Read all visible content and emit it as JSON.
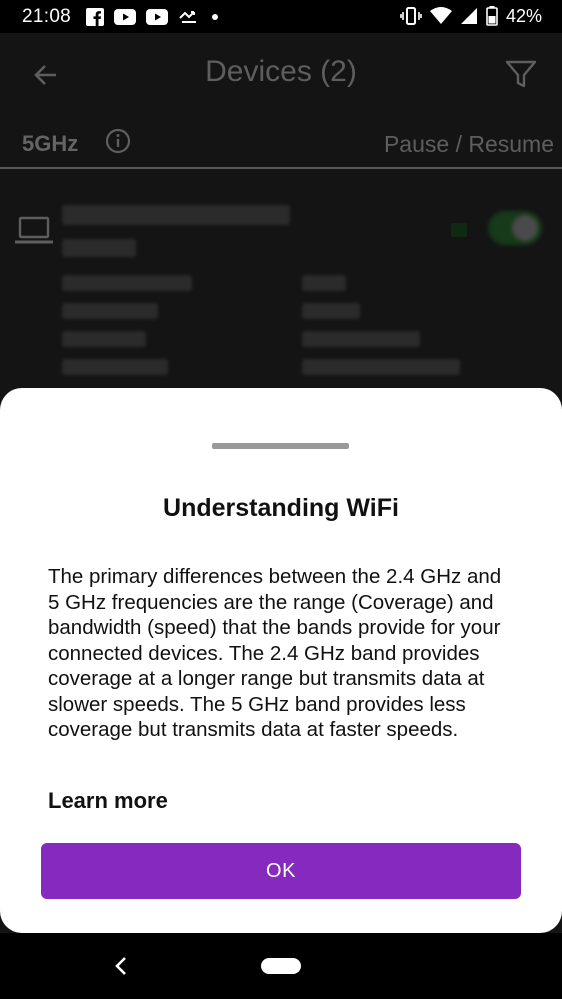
{
  "status_bar": {
    "time": "21:08",
    "battery_percent": "42%",
    "left_icons": [
      "facebook-icon",
      "youtube-icon",
      "youtube-icon",
      "sync-icon",
      "dot-icon"
    ],
    "right_icons": [
      "vibrate-icon",
      "wifi-icon",
      "cell-signal-icon",
      "battery-icon"
    ]
  },
  "header": {
    "title": "Devices (2)"
  },
  "band_row": {
    "band": "5GHz",
    "action": "Pause / Resume"
  },
  "sheet": {
    "title": "Understanding WiFi",
    "body": "The primary differences between the 2.4 GHz and 5 GHz frequencies are the range (Coverage) and bandwidth (speed) that the bands provide for your connected devices. The 2.4 GHz band provides coverage at a longer range but transmits data at slower speeds. The 5 GHz band provides less coverage but transmits data at faster speeds.",
    "learn_more": "Learn more",
    "ok_label": "OK"
  },
  "colors": {
    "accent": "#8629be",
    "scrim_background": "#141414",
    "sheet_background": "#ffffff"
  }
}
